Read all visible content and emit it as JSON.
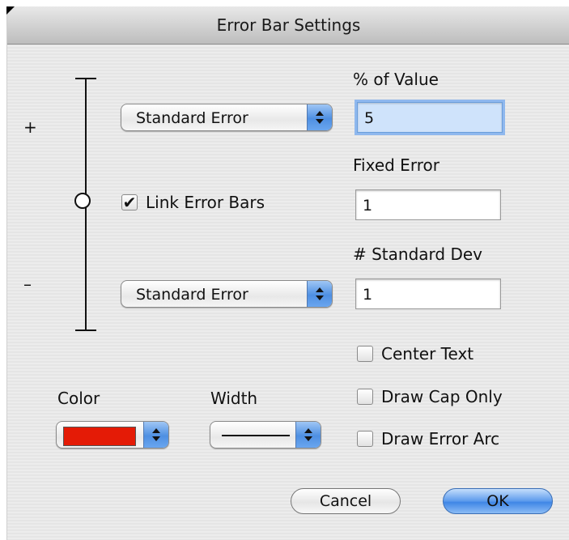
{
  "window": {
    "title": "Error Bar Settings"
  },
  "bar": {
    "plus": "+",
    "minus": "–"
  },
  "upper_popup": {
    "value": "Standard Error"
  },
  "lower_popup": {
    "value": "Standard Error"
  },
  "link": {
    "label": "Link Error Bars",
    "checked": true,
    "mark": "✔"
  },
  "percent": {
    "label": "% of Value",
    "value": "5"
  },
  "fixed": {
    "label": "Fixed Error",
    "value": "1"
  },
  "stddev": {
    "label": "# Standard Dev",
    "value": "1"
  },
  "options": {
    "center_text": {
      "label": "Center Text",
      "checked": false
    },
    "draw_cap_only": {
      "label": "Draw Cap Only",
      "checked": false
    },
    "draw_error_arc": {
      "label": "Draw Error Arc",
      "checked": false
    }
  },
  "color": {
    "label": "Color",
    "swatch_color": "#e41b06"
  },
  "width": {
    "label": "Width"
  },
  "buttons": {
    "cancel": "Cancel",
    "ok": "OK"
  },
  "icons": {
    "popup_arrows": "up-down-arrows-icon",
    "checkmark": "checkmark-icon"
  }
}
